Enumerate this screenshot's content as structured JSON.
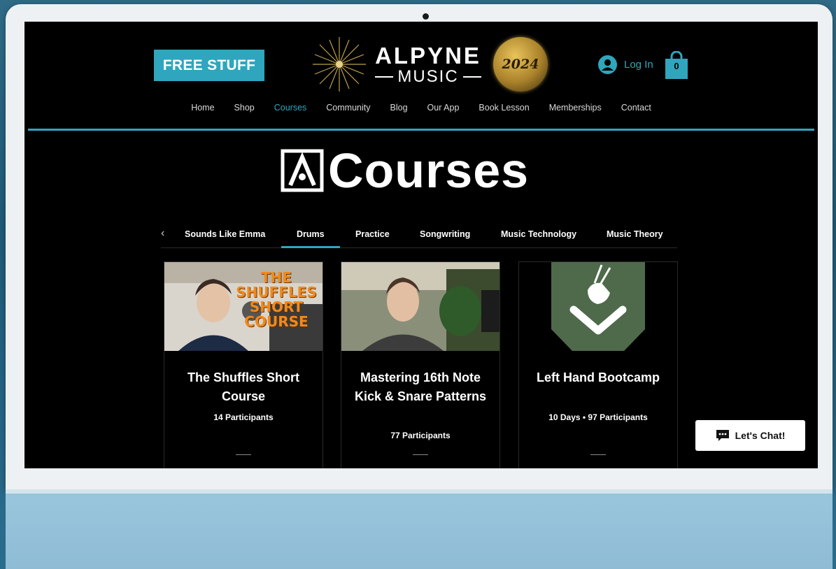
{
  "header": {
    "free_stuff": "FREE STUFF",
    "logo_line1": "ALPYNE",
    "logo_line2": "MUSIC",
    "logo_badge": "2024",
    "login": "Log In",
    "cart_count": "0"
  },
  "nav": [
    "Home",
    "Shop",
    "Courses",
    "Community",
    "Blog",
    "Our App",
    "Book Lesson",
    "Memberships",
    "Contact"
  ],
  "nav_active": "Courses",
  "page": {
    "title": "Courses"
  },
  "tabs": [
    "Sounds Like Emma",
    "Drums",
    "Practice",
    "Songwriting",
    "Music Technology",
    "Music Theory"
  ],
  "tab_active": "Drums",
  "cards": [
    {
      "title": "The Shuffles Short Course",
      "meta": "14 Participants",
      "image_text": "THE SHUFFLES SHORT COURSE"
    },
    {
      "title": "Mastering 16th Note Kick & Snare Patterns",
      "meta": "77 Participants"
    },
    {
      "title": "Left Hand Bootcamp",
      "meta": "10 Days • 97 Participants"
    }
  ],
  "chat": {
    "label": "Let's Chat!"
  },
  "colors": {
    "accent": "#2fa6bd",
    "background": "#000000",
    "badge_green": "#4e6a4a",
    "shuffle_orange": "#f08a1c"
  }
}
